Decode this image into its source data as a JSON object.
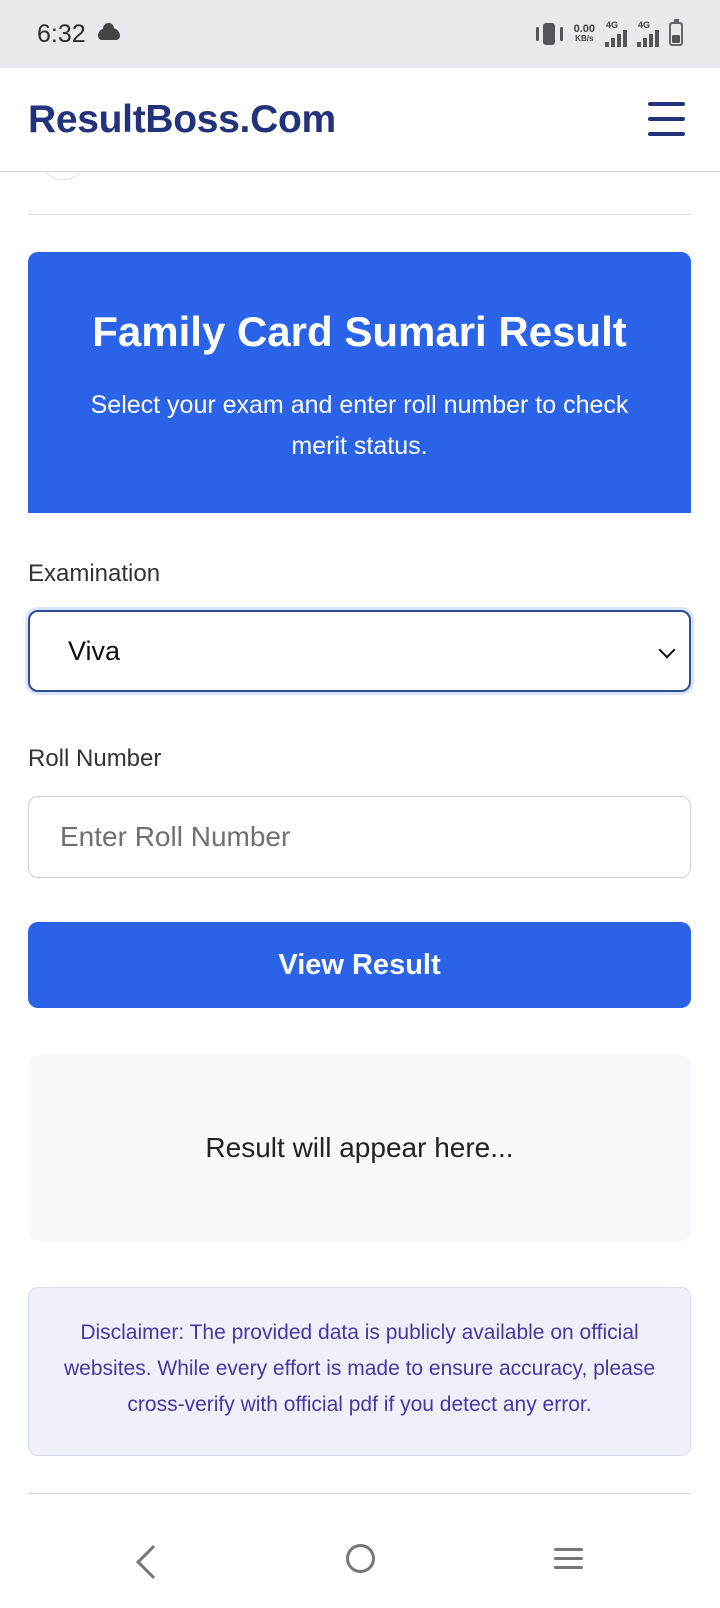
{
  "status_bar": {
    "time": "6:32",
    "cloud_icon": "cloud-icon",
    "vibrate_icon": "vibrate-icon",
    "speed_value": "0.00",
    "speed_unit": "KB/s",
    "signal_1_label": "4G",
    "signal_2_label": "4G",
    "battery_icon": "battery-icon"
  },
  "header": {
    "brand": "ResultBoss.Com",
    "menu_icon": "menu-icon"
  },
  "hero": {
    "title": "Family Card Sumari Result",
    "subtitle": "Select your exam and enter roll number to check merit status."
  },
  "form": {
    "exam_label": "Examination",
    "exam_selected": "Viva",
    "exam_chevron_icon": "chevron-down-icon",
    "roll_label": "Roll Number",
    "roll_placeholder": "Enter Roll Number",
    "view_button_label": "View Result"
  },
  "result": {
    "placeholder": "Result will appear here..."
  },
  "disclaimer": {
    "text": "Disclaimer: The provided data is publicly available on official websites. While every effort is made to ensure accuracy, please cross-verify with official pdf if you detect any error."
  },
  "system_nav": {
    "back_icon": "back-icon",
    "home_icon": "home-icon",
    "recent_icon": "recent-apps-icon"
  },
  "colors": {
    "brand_navy": "#22337c",
    "primary_blue": "#2a63e8",
    "disclaimer_text": "#4936a3"
  }
}
